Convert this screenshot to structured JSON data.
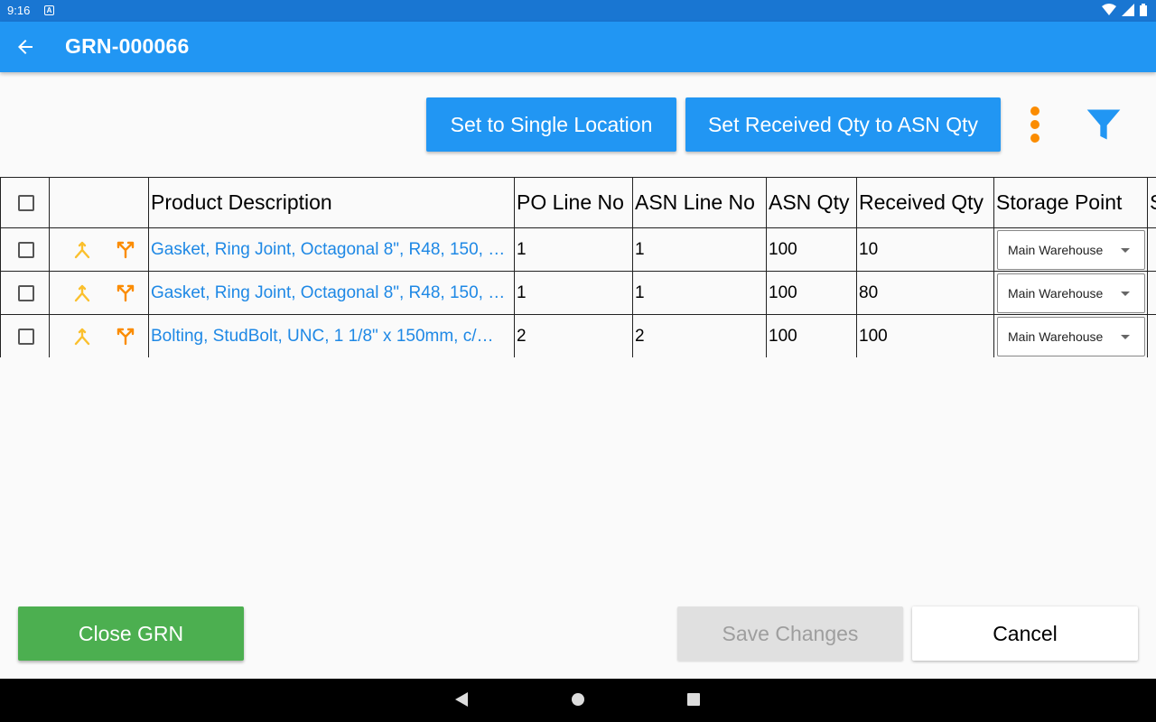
{
  "statusbar": {
    "time": "9:16",
    "notification_icon": "a-badge-icon",
    "icons": [
      "wifi-icon",
      "signal-icon",
      "battery-icon"
    ]
  },
  "appbar": {
    "title": "GRN-000066",
    "back_icon": "arrow-back-icon"
  },
  "actions": {
    "single_location_label": "Set to Single Location",
    "set_received_label": "Set Received Qty to ASN Qty",
    "more_icon": "more-vert-icon",
    "filter_icon": "filter-icon"
  },
  "table": {
    "headers": {
      "description": "Product Description",
      "po_line": "PO Line No",
      "asn_line": "ASN Line No",
      "asn_qty": "ASN Qty",
      "received_qty": "Received Qty",
      "storage_point": "Storage Point",
      "next": "S"
    },
    "rows": [
      {
        "description": "Gasket, Ring Joint, Octagonal 8\", R48, 150, …",
        "po_line": "1",
        "asn_line": "1",
        "asn_qty": "100",
        "received_qty": "10",
        "storage_point": "Main Warehouse"
      },
      {
        "description": "Gasket, Ring Joint, Octagonal 8\", R48, 150, …",
        "po_line": "1",
        "asn_line": "1",
        "asn_qty": "100",
        "received_qty": "80",
        "storage_point": "Main Warehouse"
      },
      {
        "description": "Bolting, StudBolt, UNC, 1 1/8\" x 150mm, c/…",
        "po_line": "2",
        "asn_line": "2",
        "asn_qty": "100",
        "received_qty": "100",
        "storage_point": "Main Warehouse"
      }
    ]
  },
  "footer": {
    "close_label": "Close GRN",
    "save_label": "Save Changes",
    "cancel_label": "Cancel"
  },
  "colors": {
    "appbar": "#2196f3",
    "statusbar": "#1976d2",
    "accent_orange": "#fb8c00",
    "icon_yellow": "#fbc02d",
    "close_green": "#4caf50",
    "link_blue": "#1e88e5"
  }
}
